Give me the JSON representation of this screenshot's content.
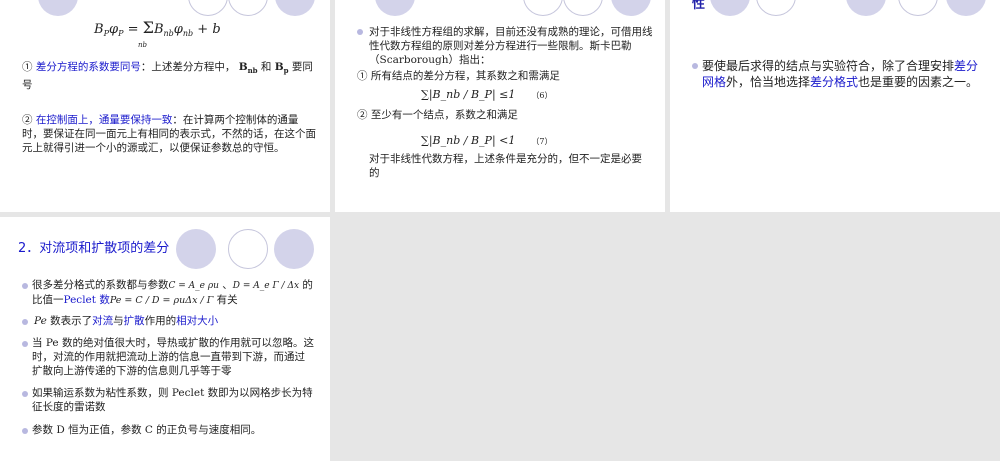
{
  "slide1": {
    "formula": "B_P φ_P = Σ B_nb φ_nb + b",
    "formula_parts": {
      "lhs": "B",
      "lhs_sub": "P",
      "phi": "φ",
      "phi_sub": "P",
      "eq": " = ",
      "sum": "Σ",
      "sum_sub": "nb",
      "b_nb": "B",
      "b_nb_sub": "nb",
      "phi_nb": "φ",
      "phi_nb_sub": "nb",
      "plus_b": " + b"
    },
    "item1_num": "①",
    "item1_highlight": "差分方程的系数要同号",
    "item1_text": "：上述差分方程中，",
    "item1_bnb": "B",
    "item1_bnb_sub": "nb",
    "item1_and": " 和 ",
    "item1_bp": "B",
    "item1_bp_sub": "p",
    "item1_tail": " 要同号",
    "item2_num": "②",
    "item2_highlight": "在控制面上，通量要保持一致",
    "item2_text": "：在计算两个控制体的通量时，要保证在同一面元上有相同的表示式，不然的话，在这个面元上就得引进一个小的源或汇，以便保证参数总的守恒。"
  },
  "slide2": {
    "bullet1": "对于非线性方程组的求解，目前还没有成熟的理论，可借用线性代数方程组的原则对差分方程进行一些限制。斯卡巴勒（Scarborough）指出：",
    "cond1": "① 所有结点的差分方程，其系数之和需满足",
    "formula6": "∑|B_nb / B_P| ≤1",
    "tag6": "（6）",
    "cond2": "② 至少有一个结点，系数之和满足",
    "formula7": "∑|B_nb / B_P| <1",
    "tag7": "（7）",
    "conclusion": "对于非线性代数方程，上述条件是充分的，但不一定是必要的"
  },
  "slide3": {
    "top_fragment": "性",
    "bullet_pre": "要使最后求得的结点与实验符合，除了合理安排",
    "bullet_hl1": "差分网格",
    "bullet_mid": "外，恰当地选择",
    "bullet_hl2": "差分格式",
    "bullet_post": "也是重要的因素之一。"
  },
  "slide4": {
    "title": "2．对流项和扩散项的差分",
    "b1_pre": "很多差分格式的系数都与参数",
    "b1_f1": "C = A_e ρu",
    "b1_sep": " 、",
    "b1_f2": "D = A_e Γ / Δx",
    "b1_mid": " 的比值一",
    "b1_peclet": "Peclet 数",
    "b1_f3": "Pe = C / D = ρuΔx / Γ",
    "b1_post": "有关",
    "b2_pe": "Pe",
    "b2_mid1": "数表示了",
    "b2_hl1": "对流",
    "b2_mid2": "与",
    "b2_hl2": "扩散",
    "b2_mid3": "作用的",
    "b2_hl3": "相对大小",
    "b3": "当 Pe 数的绝对值很大时，导热或扩散的作用就可以忽略。这时，对流的作用就把流动上游的信息一直带到下游，而通过扩散向上游传递的下游的信息则几乎等于零",
    "b4": "如果输运系数为粘性系数，则 Peclet 数即为以网格步长为特征长度的雷诺数",
    "b5": "参数 D 恒为正值，参数 C 的正负号与速度相同。"
  },
  "colors": {
    "highlight": "#1a1acc",
    "deco_fill": "#d3d3ea",
    "background": "#e6e6e6",
    "bullet": "#b8b8e0"
  }
}
